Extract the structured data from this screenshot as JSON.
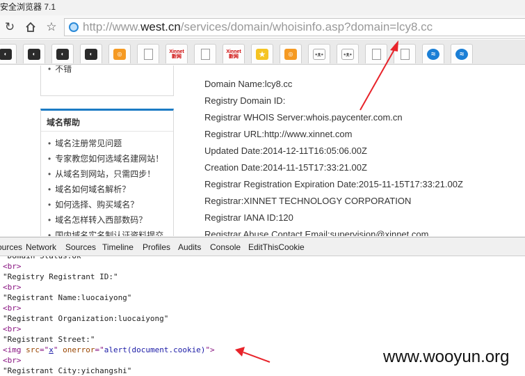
{
  "window": {
    "title": "安全浏览器 7.1"
  },
  "nav": {
    "url_prefix": "http://www.",
    "url_domain": "west.cn",
    "url_path": "/services/domain/whoisinfo.asp?domain=lcy8.cc"
  },
  "tabs": [
    {
      "icon": "dark-favicon"
    },
    {
      "icon": "dark-favicon"
    },
    {
      "icon": "dark-favicon"
    },
    {
      "icon": "dark-favicon"
    },
    {
      "icon": "orange-favicon"
    },
    {
      "icon": "page-favicon"
    },
    {
      "icon": "xinnet-favicon"
    },
    {
      "icon": "page-favicon"
    },
    {
      "icon": "xinnet-favicon"
    },
    {
      "icon": "star-favicon"
    },
    {
      "icon": "orange-favicon"
    },
    {
      "icon": "cat-favicon"
    },
    {
      "icon": "cat-favicon"
    },
    {
      "icon": "page-favicon"
    },
    {
      "icon": "page-favicon"
    },
    {
      "icon": "blue-favicon"
    },
    {
      "icon": "blue-favicon"
    }
  ],
  "xinnet_label": {
    "top": "Xinnet",
    "bottom": "新网"
  },
  "sidebar": {
    "top_item": "不错",
    "help_title": "域名帮助",
    "help_items": [
      "域名注册常见问题",
      "专家教您如何选域名建网站！",
      "从域名到网站，只需四步！",
      "域名如何域名解析？",
      "如何选择、购买域名？",
      "域名怎样转入西部数码？",
      "国内域名实名制认证资料提交"
    ]
  },
  "whois": [
    "Domain Name:lcy8.cc",
    "Registry Domain ID:",
    "Registrar WHOIS Server:whois.paycenter.com.cn",
    "Registrar URL:http://www.xinnet.com",
    "Updated Date:2014-12-11T16:05:06.00Z",
    "Creation Date:2014-11-15T17:33:21.00Z",
    "Registrar Registration Expiration Date:2015-11-15T17:33:21.00Z",
    "Registrar:XINNET TECHNOLOGY CORPORATION",
    "Registrar IANA ID:120",
    "Registrar Abuse Contact Email:supervision@xinnet.com"
  ],
  "devtools": {
    "tabs": [
      "ources",
      "Network",
      "Sources",
      "Timeline",
      "Profiles",
      "Audits",
      "Console",
      "EditThisCookie"
    ],
    "lines": [
      "\"Domain Status:ok\"",
      "<br>",
      "\"Registry Registrant ID:\"",
      "<br>",
      "\"Registrant Name:luocaiyong\"",
      "<br>",
      "\"Registrant Organization:luocaiyong\"",
      "<br>",
      "\"Registrant Street:\"",
      "<img>",
      "<br>",
      "\"Registrant City:yichangshi\""
    ],
    "img_tag": {
      "open": "<img ",
      "src_attr": "src",
      "eq1": "=\"",
      "src_val": "x",
      "q1": "\" ",
      "onerror_attr": "onerror",
      "eq2": "=\"",
      "onerror_val": "alert(document.cookie)",
      "close": "\">"
    }
  },
  "watermark": "www.wooyun.org",
  "colors": {
    "accent_blue": "#1c7bc4",
    "arrow_red": "#e8232a"
  }
}
